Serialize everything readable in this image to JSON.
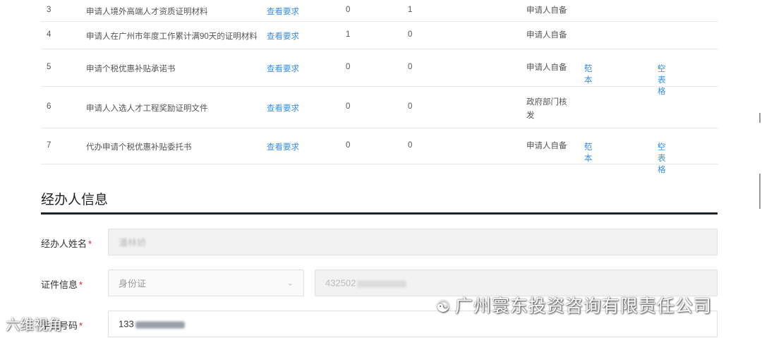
{
  "materials": [
    {
      "no": "3",
      "name": "申请人境外高端人才资质证明材料",
      "link": "查看要求",
      "a": "0",
      "b": "1",
      "source": "申请人自备",
      "template": "",
      "blank": ""
    },
    {
      "no": "4",
      "name": "申请人在广州市年度工作累计满90天的证明材料",
      "link": "查看要求",
      "a": "1",
      "b": "0",
      "source": "申请人自备",
      "template": "",
      "blank": ""
    },
    {
      "no": "5",
      "name": "申请个税优惠补贴承诺书",
      "link": "查看要求",
      "a": "0",
      "b": "0",
      "source": "申请人自备",
      "template": "范本",
      "blank": "空表格"
    },
    {
      "no": "6",
      "name": "申请人入选人才工程奖励证明文件",
      "link": "查看要求",
      "a": "0",
      "b": "0",
      "source": "政府部门核发",
      "template": "",
      "blank": ""
    },
    {
      "no": "7",
      "name": "代办申请个税优惠补贴委托书",
      "link": "查看要求",
      "a": "0",
      "b": "0",
      "source": "申请人自备",
      "template": "范本",
      "blank": "空表格"
    }
  ],
  "agent_section": {
    "title": "经办人信息",
    "name_label": "经办人姓名",
    "name_value": "潘林娇",
    "id_label": "证件信息",
    "id_type": "身份证",
    "id_number_prefix": "432502",
    "phone_label": "手机号码",
    "phone_prefix": "133"
  },
  "watermark": {
    "text": "广州寰东投资咨询有限责任公司",
    "corner_text": "六维视角"
  },
  "icons": {
    "download": "download-icon",
    "chevron": "chevron-down-icon",
    "wechat": "wechat-icon"
  }
}
